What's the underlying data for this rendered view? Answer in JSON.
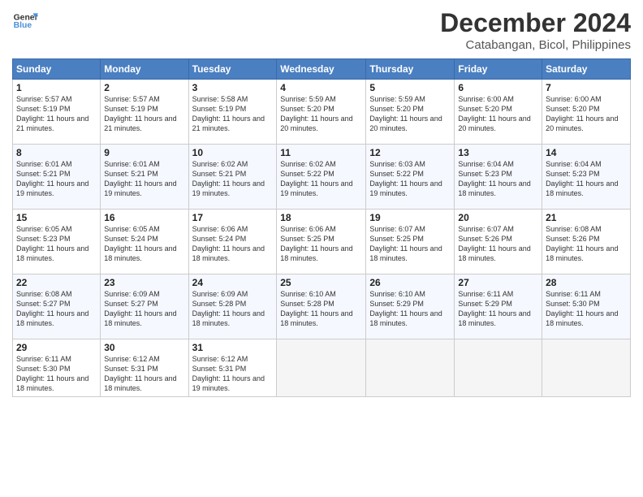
{
  "logo": {
    "line1": "General",
    "line2": "Blue"
  },
  "title": "December 2024",
  "subtitle": "Catabangan, Bicol, Philippines",
  "days_header": [
    "Sunday",
    "Monday",
    "Tuesday",
    "Wednesday",
    "Thursday",
    "Friday",
    "Saturday"
  ],
  "weeks": [
    [
      {
        "day": "1",
        "sunrise": "5:57 AM",
        "sunset": "5:19 PM",
        "daylight": "11 hours and 21 minutes."
      },
      {
        "day": "2",
        "sunrise": "5:57 AM",
        "sunset": "5:19 PM",
        "daylight": "11 hours and 21 minutes."
      },
      {
        "day": "3",
        "sunrise": "5:58 AM",
        "sunset": "5:19 PM",
        "daylight": "11 hours and 21 minutes."
      },
      {
        "day": "4",
        "sunrise": "5:59 AM",
        "sunset": "5:20 PM",
        "daylight": "11 hours and 20 minutes."
      },
      {
        "day": "5",
        "sunrise": "5:59 AM",
        "sunset": "5:20 PM",
        "daylight": "11 hours and 20 minutes."
      },
      {
        "day": "6",
        "sunrise": "6:00 AM",
        "sunset": "5:20 PM",
        "daylight": "11 hours and 20 minutes."
      },
      {
        "day": "7",
        "sunrise": "6:00 AM",
        "sunset": "5:20 PM",
        "daylight": "11 hours and 20 minutes."
      }
    ],
    [
      {
        "day": "8",
        "sunrise": "6:01 AM",
        "sunset": "5:21 PM",
        "daylight": "11 hours and 19 minutes."
      },
      {
        "day": "9",
        "sunrise": "6:01 AM",
        "sunset": "5:21 PM",
        "daylight": "11 hours and 19 minutes."
      },
      {
        "day": "10",
        "sunrise": "6:02 AM",
        "sunset": "5:21 PM",
        "daylight": "11 hours and 19 minutes."
      },
      {
        "day": "11",
        "sunrise": "6:02 AM",
        "sunset": "5:22 PM",
        "daylight": "11 hours and 19 minutes."
      },
      {
        "day": "12",
        "sunrise": "6:03 AM",
        "sunset": "5:22 PM",
        "daylight": "11 hours and 19 minutes."
      },
      {
        "day": "13",
        "sunrise": "6:04 AM",
        "sunset": "5:23 PM",
        "daylight": "11 hours and 18 minutes."
      },
      {
        "day": "14",
        "sunrise": "6:04 AM",
        "sunset": "5:23 PM",
        "daylight": "11 hours and 18 minutes."
      }
    ],
    [
      {
        "day": "15",
        "sunrise": "6:05 AM",
        "sunset": "5:23 PM",
        "daylight": "11 hours and 18 minutes."
      },
      {
        "day": "16",
        "sunrise": "6:05 AM",
        "sunset": "5:24 PM",
        "daylight": "11 hours and 18 minutes."
      },
      {
        "day": "17",
        "sunrise": "6:06 AM",
        "sunset": "5:24 PM",
        "daylight": "11 hours and 18 minutes."
      },
      {
        "day": "18",
        "sunrise": "6:06 AM",
        "sunset": "5:25 PM",
        "daylight": "11 hours and 18 minutes."
      },
      {
        "day": "19",
        "sunrise": "6:07 AM",
        "sunset": "5:25 PM",
        "daylight": "11 hours and 18 minutes."
      },
      {
        "day": "20",
        "sunrise": "6:07 AM",
        "sunset": "5:26 PM",
        "daylight": "11 hours and 18 minutes."
      },
      {
        "day": "21",
        "sunrise": "6:08 AM",
        "sunset": "5:26 PM",
        "daylight": "11 hours and 18 minutes."
      }
    ],
    [
      {
        "day": "22",
        "sunrise": "6:08 AM",
        "sunset": "5:27 PM",
        "daylight": "11 hours and 18 minutes."
      },
      {
        "day": "23",
        "sunrise": "6:09 AM",
        "sunset": "5:27 PM",
        "daylight": "11 hours and 18 minutes."
      },
      {
        "day": "24",
        "sunrise": "6:09 AM",
        "sunset": "5:28 PM",
        "daylight": "11 hours and 18 minutes."
      },
      {
        "day": "25",
        "sunrise": "6:10 AM",
        "sunset": "5:28 PM",
        "daylight": "11 hours and 18 minutes."
      },
      {
        "day": "26",
        "sunrise": "6:10 AM",
        "sunset": "5:29 PM",
        "daylight": "11 hours and 18 minutes."
      },
      {
        "day": "27",
        "sunrise": "6:11 AM",
        "sunset": "5:29 PM",
        "daylight": "11 hours and 18 minutes."
      },
      {
        "day": "28",
        "sunrise": "6:11 AM",
        "sunset": "5:30 PM",
        "daylight": "11 hours and 18 minutes."
      }
    ],
    [
      {
        "day": "29",
        "sunrise": "6:11 AM",
        "sunset": "5:30 PM",
        "daylight": "11 hours and 18 minutes."
      },
      {
        "day": "30",
        "sunrise": "6:12 AM",
        "sunset": "5:31 PM",
        "daylight": "11 hours and 18 minutes."
      },
      {
        "day": "31",
        "sunrise": "6:12 AM",
        "sunset": "5:31 PM",
        "daylight": "11 hours and 19 minutes."
      },
      null,
      null,
      null,
      null
    ]
  ]
}
